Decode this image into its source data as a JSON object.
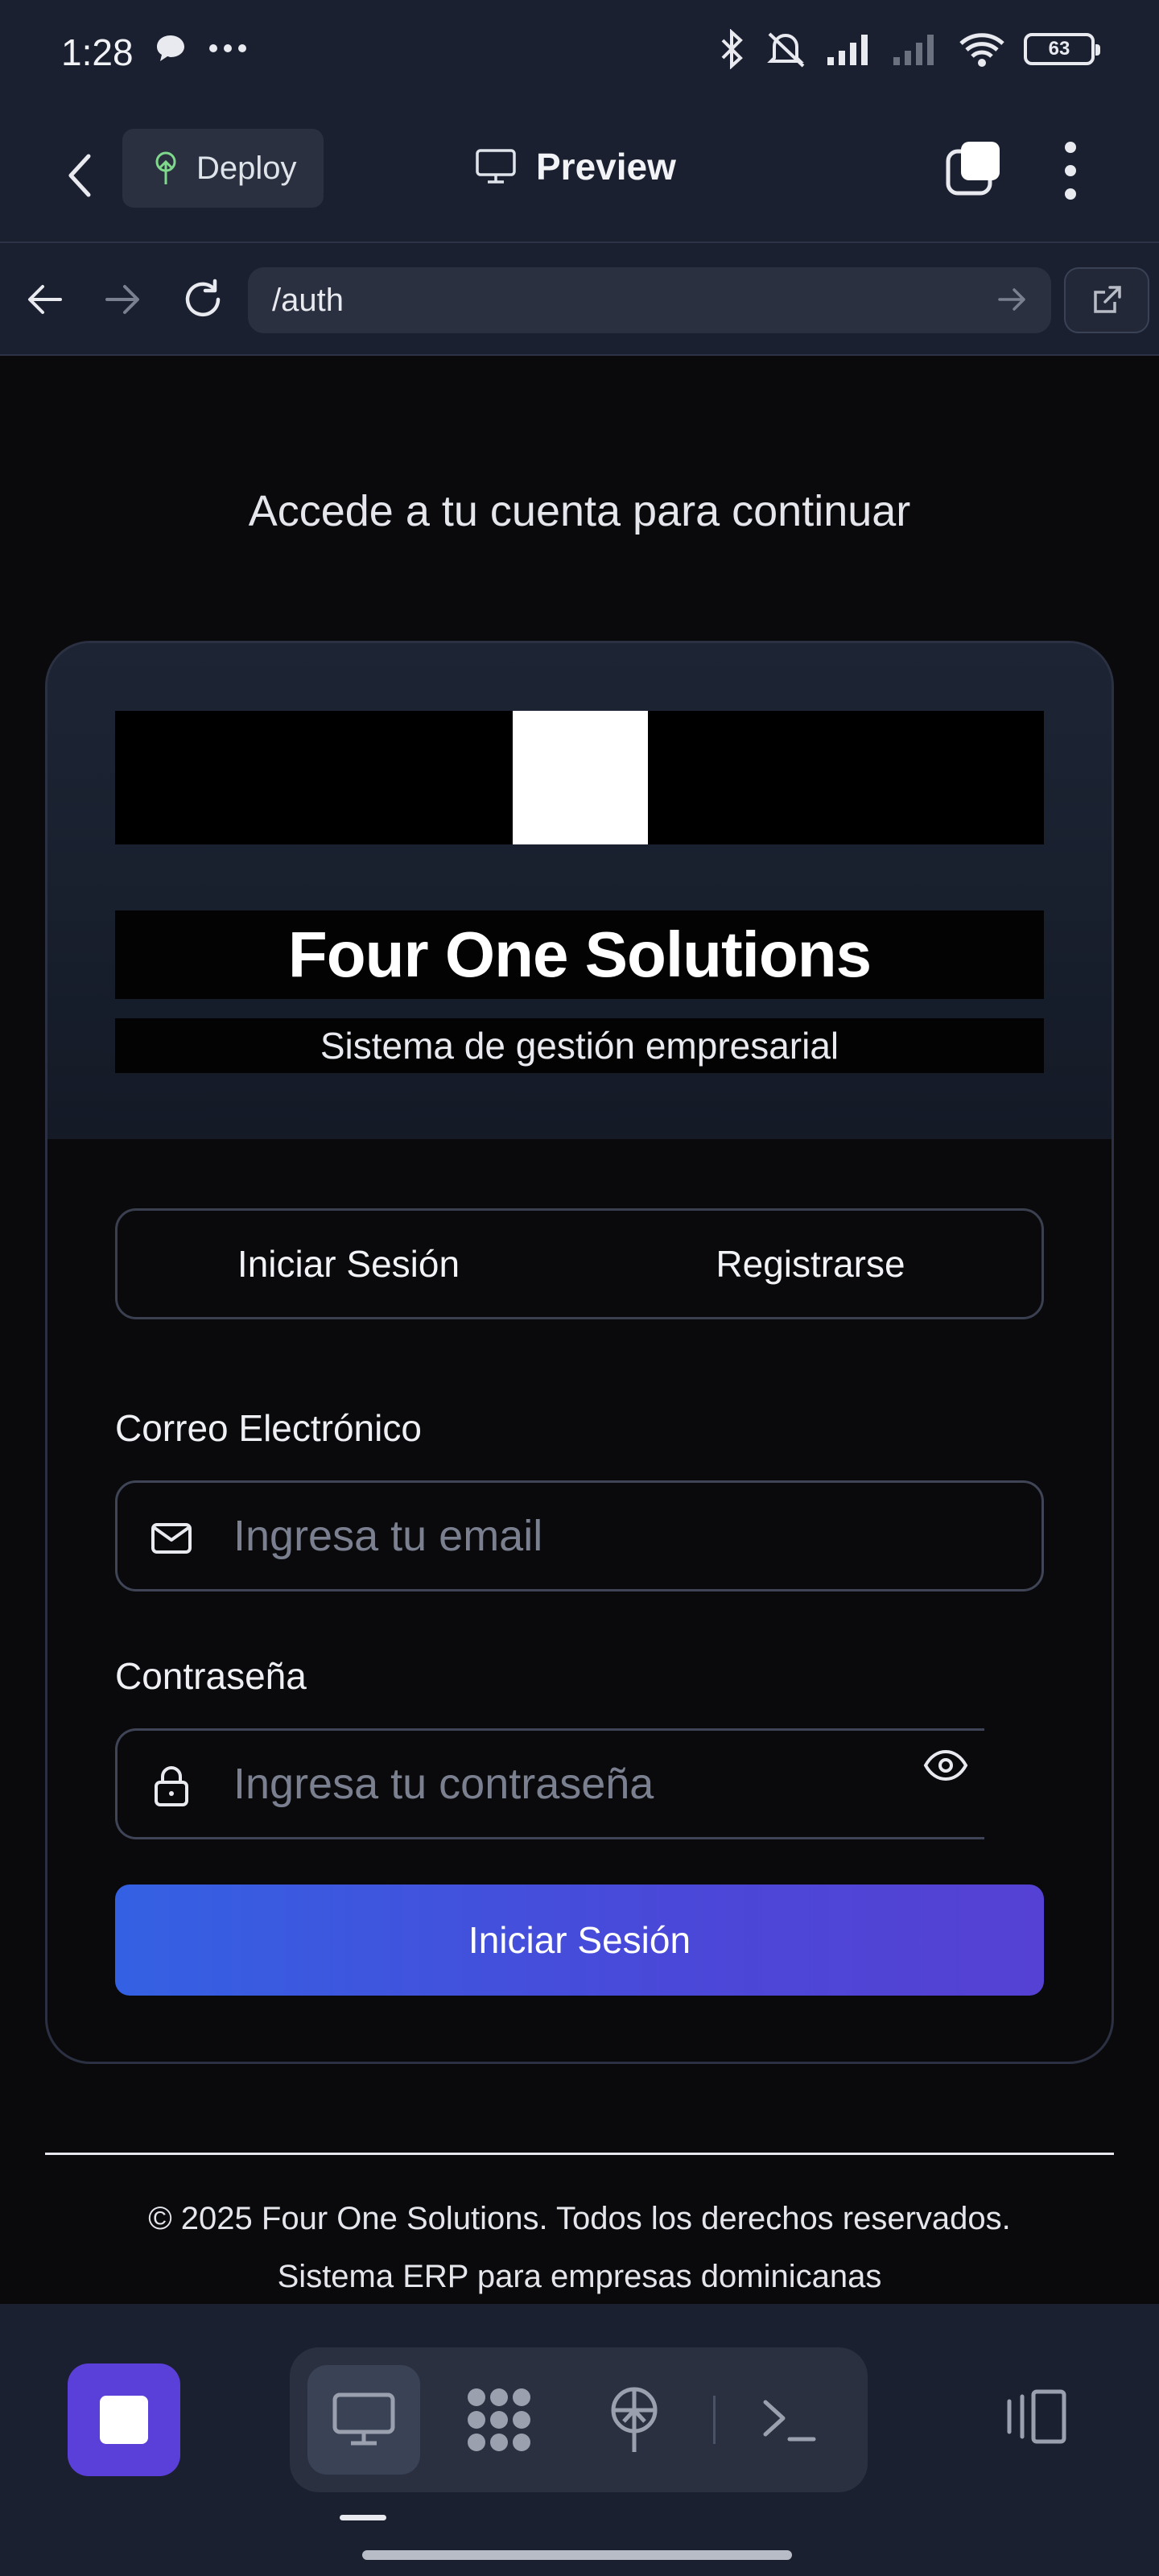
{
  "status_bar": {
    "time": "1:28",
    "battery": "63"
  },
  "app_header": {
    "deploy_label": "Deploy",
    "title": "Preview"
  },
  "browser": {
    "url": "/auth"
  },
  "page": {
    "subtitle": "Accede a tu cuenta para continuar",
    "brand_name": "Four One Solutions",
    "tagline": "Sistema de gestión empresarial",
    "tabs": [
      {
        "label": "Iniciar Sesión",
        "active": true
      },
      {
        "label": "Registrarse",
        "active": false
      }
    ],
    "email": {
      "label": "Correo Electrónico",
      "placeholder": "Ingresa tu email",
      "value": ""
    },
    "password": {
      "label": "Contraseña",
      "placeholder": "Ingresa tu contraseña",
      "value": ""
    },
    "submit_label": "Iniciar Sesión",
    "footer": {
      "copyright": "© 2025 Four One Solutions. Todos los derechos reservados.",
      "description": "Sistema ERP para empresas dominicanas"
    }
  },
  "bottom_bar": {
    "tools": [
      "monitor-icon",
      "tools-grid-icon",
      "deploy-icon",
      "terminal-icon"
    ],
    "active_tool": "monitor-icon"
  },
  "colors": {
    "accent_start": "#3461e3",
    "accent_end": "#5541d3",
    "stop_button": "#5b3fd9",
    "chrome_bg": "#1b2030"
  }
}
